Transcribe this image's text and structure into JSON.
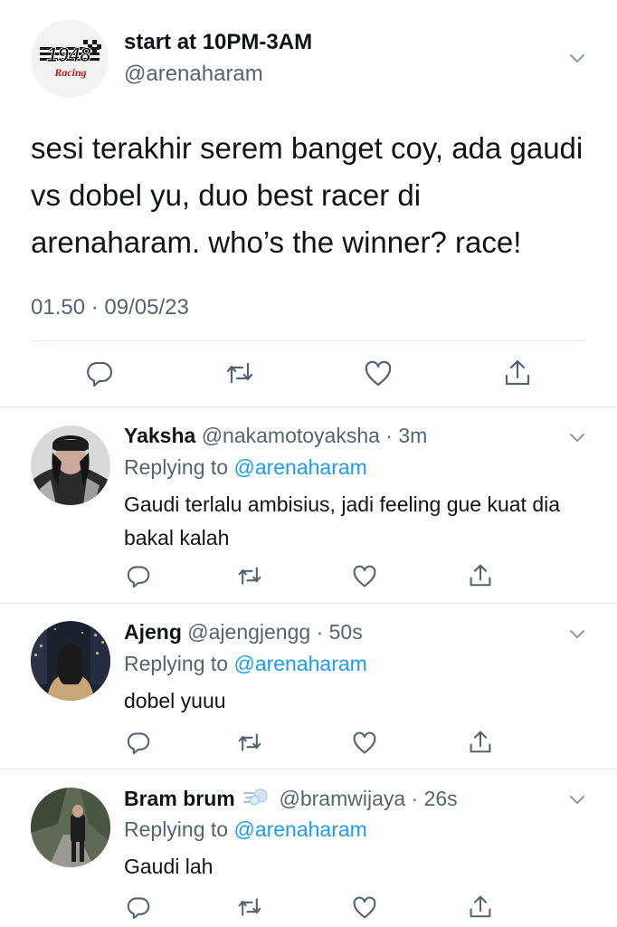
{
  "main_tweet": {
    "display_name": "start at 10PM-3AM",
    "handle": "@arenaharam",
    "text": "sesi terakhir serem banget coy, ada gaudi vs dobel yu, duo best racer di arenaharam. who’s the winner? race!",
    "timestamp": "01.50 · 09/05/23",
    "logo_text": "1948",
    "logo_script": "Racing",
    "actions": [
      "reply-icon",
      "retweet-icon",
      "like-icon",
      "share-icon"
    ]
  },
  "replies": [
    {
      "name": "Yaksha",
      "handle_time": "@nakamotoyaksha · 3m",
      "replying_prefix": "Replying to ",
      "replying_mention": "@arenaharam",
      "text": "Gaudi terlalu ambisius, jadi feeling gue kuat dia bakal kalah"
    },
    {
      "name": "Ajeng",
      "handle_time": "@ajengjengg · 50s",
      "replying_prefix": "Replying to ",
      "replying_mention": "@arenaharam",
      "text": "dobel yuuu"
    },
    {
      "name": "Bram brum",
      "name_emoji": "dash-emoji",
      "handle_time": "@bramwijaya · 26s",
      "replying_prefix": "Replying to ",
      "replying_mention": "@arenaharam",
      "text": "Gaudi lah"
    }
  ],
  "colors": {
    "text": "#0f1419",
    "secondary": "#536471",
    "link": "#1d9bf0",
    "divider": "#e1e8ed"
  }
}
